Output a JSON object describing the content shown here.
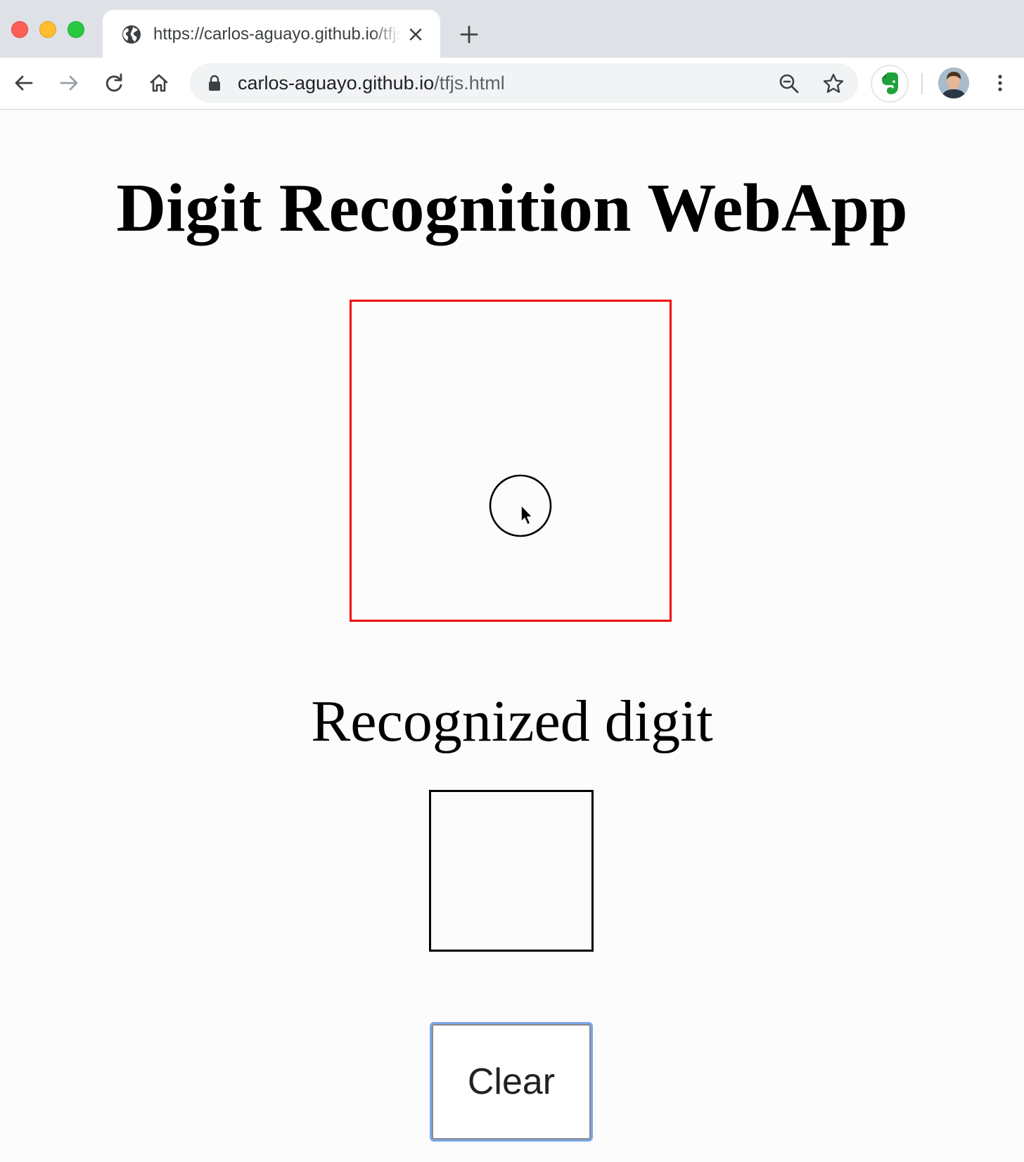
{
  "browser": {
    "tab": {
      "title": "https://carlos-aguayo.github.io/tfjs.html",
      "favicon": "globe-icon"
    },
    "address_bar": {
      "host": "carlos-aguayo.github.io",
      "path": "/tfjs.html"
    },
    "colors": {
      "tabstrip": "#dee1e6",
      "omnibox": "#f1f3f4",
      "focus_ring": "#7aa6ea"
    },
    "icons": [
      "back-icon",
      "forward-icon",
      "reload-icon",
      "home-icon",
      "lock-icon",
      "zoom-out-icon",
      "star-icon",
      "evernote-icon",
      "avatar",
      "more-menu-icon"
    ]
  },
  "page": {
    "title": "Digit Recognition WebApp",
    "canvas": {
      "border_color": "#ee0d0d"
    },
    "result": {
      "label": "Recognized digit",
      "value": ""
    },
    "clear_button": {
      "label": "Clear"
    }
  }
}
